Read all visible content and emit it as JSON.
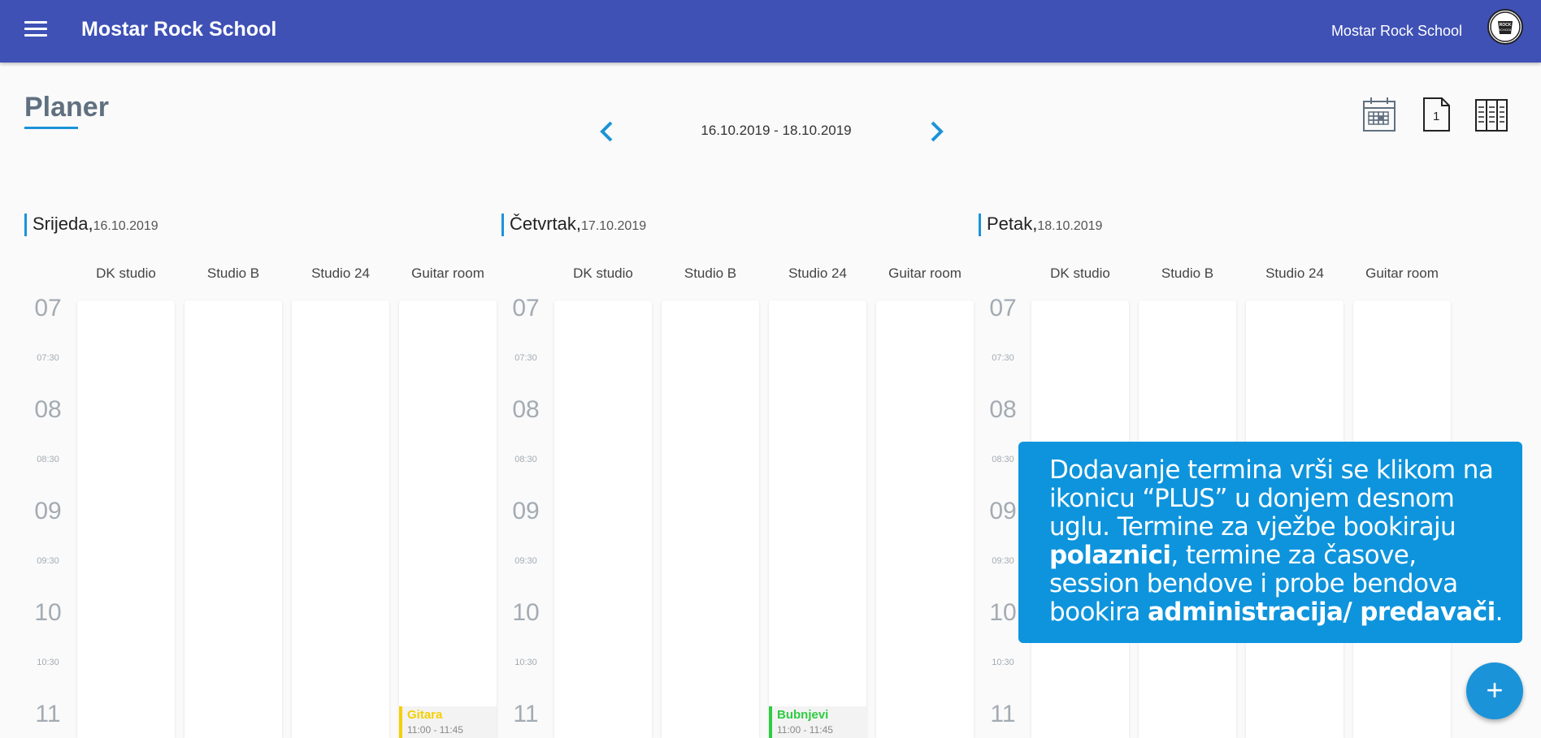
{
  "appbar": {
    "title": "Mostar Rock School",
    "school_name": "Mostar Rock School",
    "menu_icon": "menu-icon",
    "avatar_icon": "school-logo"
  },
  "page": {
    "title": "Planer"
  },
  "navigation": {
    "date_range": "16.10.2019  -  18.10.2019",
    "prev_icon": "chevron-left-icon",
    "next_icon": "chevron-right-icon"
  },
  "view_switcher": [
    {
      "name": "calendar-view-icon"
    },
    {
      "name": "day-view-icon",
      "label": "1"
    },
    {
      "name": "list-view-icon"
    }
  ],
  "days": [
    {
      "name": "Srijeda,",
      "date": "16.10.2019",
      "rooms": [
        "DK studio",
        "Studio B",
        "Studio 24",
        "Guitar room"
      ],
      "events": [
        {
          "room_index": 3,
          "title": "Gitara",
          "time": "11:00 - 11:45",
          "color": "#f5d000"
        }
      ]
    },
    {
      "name": "Četvrtak,",
      "date": "17.10.2019",
      "rooms": [
        "DK studio",
        "Studio B",
        "Studio 24",
        "Guitar room"
      ],
      "events": [
        {
          "room_index": 2,
          "title": "Bubnjevi",
          "time": "11:00 - 11:45",
          "color": "#2ecc40"
        }
      ]
    },
    {
      "name": "Petak,",
      "date": "18.10.2019",
      "rooms": [
        "DK studio",
        "Studio B",
        "Studio 24",
        "Guitar room"
      ],
      "events": []
    }
  ],
  "timeline": {
    "hours": [
      "07",
      "08",
      "09",
      "10",
      "11"
    ],
    "halves": [
      "07:30",
      "08:30",
      "09:30",
      "10:30"
    ]
  },
  "tooltip": {
    "part1": "Dodavanje termina vrši se klikom na ikonicu “PLUS” u donjem desnom uglu. Termine za vježbe bookiraju ",
    "bold1": "polaznici",
    "part2": ", termine za časove, session bendove i probe bendova bookira ",
    "bold2": "administracija/ predavači",
    "part3": "."
  },
  "fab": {
    "label": "+"
  },
  "colors": {
    "appbar": "#3f51b5",
    "accent": "#1b93d8",
    "tooltip": "#0e94dc"
  }
}
